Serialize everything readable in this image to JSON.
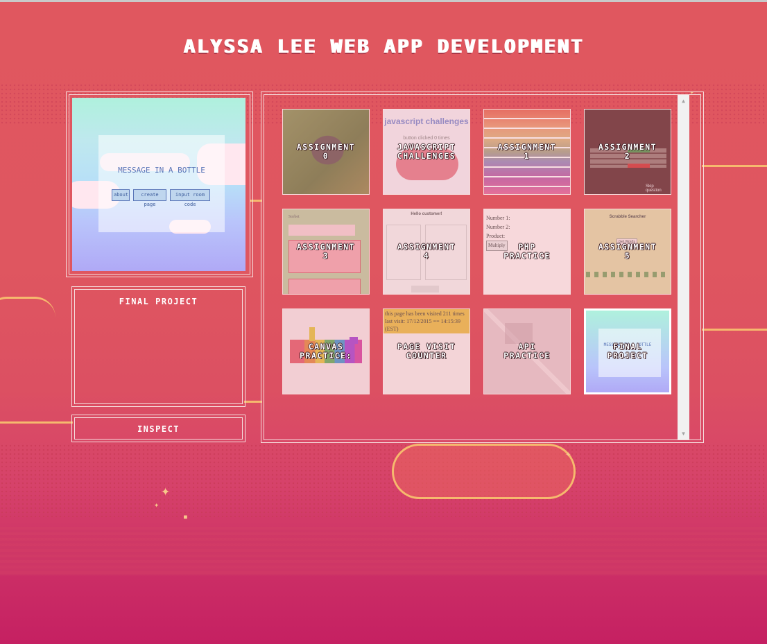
{
  "colors": {
    "background": "#df5660",
    "accent_gold": "#f6b96e",
    "panel_border": "#f6dede",
    "text": "#ffffff"
  },
  "header": {
    "title": "ALYSSA LEE WEB APP DEVELOPMENT"
  },
  "preview": {
    "site_title": "MESSAGE IN A BOTTLE",
    "buttons": [
      "about",
      "create page",
      "input room code"
    ]
  },
  "details": {
    "label": "FINAL PROJECT"
  },
  "inspect": {
    "label": "INSPECT"
  },
  "gallery": {
    "tiles": [
      {
        "label": "ASSIGNMENT\n0",
        "thumb": "dog-photo"
      },
      {
        "label": "JAVASCRIPT\nCHALLENGES",
        "thumb": "js-challenges",
        "thumb_title": "javascript challenges",
        "thumb_text": "button clicked 0 times"
      },
      {
        "label": "ASSIGNMENT\n1",
        "thumb": "color-grid"
      },
      {
        "label": "ASSIGNMENT\n2",
        "thumb": "quiz-table",
        "thumb_text": "Skip question"
      },
      {
        "label": "ASSIGNMENT\n3",
        "thumb": "sorbet-page",
        "thumb_text": "Sorbet"
      },
      {
        "label": "ASSIGNMENT\n4",
        "thumb": "customer-form",
        "thumb_title": "Hello customer!"
      },
      {
        "label": "PHP\nPRACTICE",
        "thumb": "php-form",
        "thumb_lines": [
          "Number 1:",
          "Number 2:",
          "Product:",
          "Multiply"
        ]
      },
      {
        "label": "ASSIGNMENT\n5",
        "thumb": "scrabble",
        "thumb_title": "Scrabble Searcher",
        "thumb_text": "Get Words"
      },
      {
        "label": "CANVAS\nPRACTICE:",
        "thumb": "canvas-bars"
      },
      {
        "label": "PAGE VISIT\nCOUNTER",
        "thumb": "visit-counter",
        "thumb_lines": [
          "this page has been visited 211 times",
          "last visit: 17/12/2015 == 14:15:39 (EST)"
        ]
      },
      {
        "label": "API\nPRACTICE",
        "thumb": "map"
      },
      {
        "label": "FINAL\nPROJECT",
        "thumb": "final-project",
        "thumb_title": "MESSAGE IN A BOTTLE",
        "active": true
      }
    ]
  },
  "scrollbar": {
    "up": "▲",
    "down": "▼"
  }
}
